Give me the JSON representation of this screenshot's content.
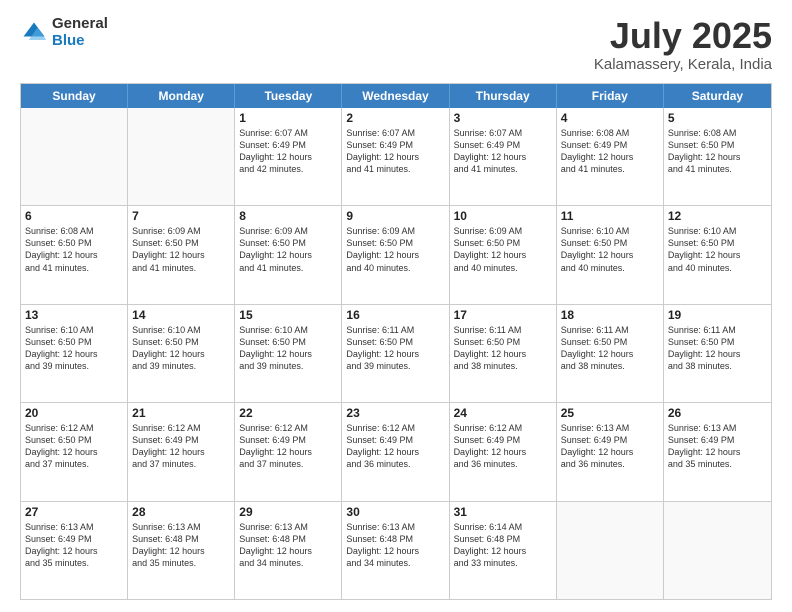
{
  "logo": {
    "general": "General",
    "blue": "Blue"
  },
  "calendar": {
    "title": "July 2025",
    "subtitle": "Kalamassery, Kerala, India",
    "days": [
      "Sunday",
      "Monday",
      "Tuesday",
      "Wednesday",
      "Thursday",
      "Friday",
      "Saturday"
    ],
    "weeks": [
      [
        {
          "day": "",
          "lines": []
        },
        {
          "day": "",
          "lines": []
        },
        {
          "day": "1",
          "lines": [
            "Sunrise: 6:07 AM",
            "Sunset: 6:49 PM",
            "Daylight: 12 hours",
            "and 42 minutes."
          ]
        },
        {
          "day": "2",
          "lines": [
            "Sunrise: 6:07 AM",
            "Sunset: 6:49 PM",
            "Daylight: 12 hours",
            "and 41 minutes."
          ]
        },
        {
          "day": "3",
          "lines": [
            "Sunrise: 6:07 AM",
            "Sunset: 6:49 PM",
            "Daylight: 12 hours",
            "and 41 minutes."
          ]
        },
        {
          "day": "4",
          "lines": [
            "Sunrise: 6:08 AM",
            "Sunset: 6:49 PM",
            "Daylight: 12 hours",
            "and 41 minutes."
          ]
        },
        {
          "day": "5",
          "lines": [
            "Sunrise: 6:08 AM",
            "Sunset: 6:50 PM",
            "Daylight: 12 hours",
            "and 41 minutes."
          ]
        }
      ],
      [
        {
          "day": "6",
          "lines": [
            "Sunrise: 6:08 AM",
            "Sunset: 6:50 PM",
            "Daylight: 12 hours",
            "and 41 minutes."
          ]
        },
        {
          "day": "7",
          "lines": [
            "Sunrise: 6:09 AM",
            "Sunset: 6:50 PM",
            "Daylight: 12 hours",
            "and 41 minutes."
          ]
        },
        {
          "day": "8",
          "lines": [
            "Sunrise: 6:09 AM",
            "Sunset: 6:50 PM",
            "Daylight: 12 hours",
            "and 41 minutes."
          ]
        },
        {
          "day": "9",
          "lines": [
            "Sunrise: 6:09 AM",
            "Sunset: 6:50 PM",
            "Daylight: 12 hours",
            "and 40 minutes."
          ]
        },
        {
          "day": "10",
          "lines": [
            "Sunrise: 6:09 AM",
            "Sunset: 6:50 PM",
            "Daylight: 12 hours",
            "and 40 minutes."
          ]
        },
        {
          "day": "11",
          "lines": [
            "Sunrise: 6:10 AM",
            "Sunset: 6:50 PM",
            "Daylight: 12 hours",
            "and 40 minutes."
          ]
        },
        {
          "day": "12",
          "lines": [
            "Sunrise: 6:10 AM",
            "Sunset: 6:50 PM",
            "Daylight: 12 hours",
            "and 40 minutes."
          ]
        }
      ],
      [
        {
          "day": "13",
          "lines": [
            "Sunrise: 6:10 AM",
            "Sunset: 6:50 PM",
            "Daylight: 12 hours",
            "and 39 minutes."
          ]
        },
        {
          "day": "14",
          "lines": [
            "Sunrise: 6:10 AM",
            "Sunset: 6:50 PM",
            "Daylight: 12 hours",
            "and 39 minutes."
          ]
        },
        {
          "day": "15",
          "lines": [
            "Sunrise: 6:10 AM",
            "Sunset: 6:50 PM",
            "Daylight: 12 hours",
            "and 39 minutes."
          ]
        },
        {
          "day": "16",
          "lines": [
            "Sunrise: 6:11 AM",
            "Sunset: 6:50 PM",
            "Daylight: 12 hours",
            "and 39 minutes."
          ]
        },
        {
          "day": "17",
          "lines": [
            "Sunrise: 6:11 AM",
            "Sunset: 6:50 PM",
            "Daylight: 12 hours",
            "and 38 minutes."
          ]
        },
        {
          "day": "18",
          "lines": [
            "Sunrise: 6:11 AM",
            "Sunset: 6:50 PM",
            "Daylight: 12 hours",
            "and 38 minutes."
          ]
        },
        {
          "day": "19",
          "lines": [
            "Sunrise: 6:11 AM",
            "Sunset: 6:50 PM",
            "Daylight: 12 hours",
            "and 38 minutes."
          ]
        }
      ],
      [
        {
          "day": "20",
          "lines": [
            "Sunrise: 6:12 AM",
            "Sunset: 6:50 PM",
            "Daylight: 12 hours",
            "and 37 minutes."
          ]
        },
        {
          "day": "21",
          "lines": [
            "Sunrise: 6:12 AM",
            "Sunset: 6:49 PM",
            "Daylight: 12 hours",
            "and 37 minutes."
          ]
        },
        {
          "day": "22",
          "lines": [
            "Sunrise: 6:12 AM",
            "Sunset: 6:49 PM",
            "Daylight: 12 hours",
            "and 37 minutes."
          ]
        },
        {
          "day": "23",
          "lines": [
            "Sunrise: 6:12 AM",
            "Sunset: 6:49 PM",
            "Daylight: 12 hours",
            "and 36 minutes."
          ]
        },
        {
          "day": "24",
          "lines": [
            "Sunrise: 6:12 AM",
            "Sunset: 6:49 PM",
            "Daylight: 12 hours",
            "and 36 minutes."
          ]
        },
        {
          "day": "25",
          "lines": [
            "Sunrise: 6:13 AM",
            "Sunset: 6:49 PM",
            "Daylight: 12 hours",
            "and 36 minutes."
          ]
        },
        {
          "day": "26",
          "lines": [
            "Sunrise: 6:13 AM",
            "Sunset: 6:49 PM",
            "Daylight: 12 hours",
            "and 35 minutes."
          ]
        }
      ],
      [
        {
          "day": "27",
          "lines": [
            "Sunrise: 6:13 AM",
            "Sunset: 6:49 PM",
            "Daylight: 12 hours",
            "and 35 minutes."
          ]
        },
        {
          "day": "28",
          "lines": [
            "Sunrise: 6:13 AM",
            "Sunset: 6:48 PM",
            "Daylight: 12 hours",
            "and 35 minutes."
          ]
        },
        {
          "day": "29",
          "lines": [
            "Sunrise: 6:13 AM",
            "Sunset: 6:48 PM",
            "Daylight: 12 hours",
            "and 34 minutes."
          ]
        },
        {
          "day": "30",
          "lines": [
            "Sunrise: 6:13 AM",
            "Sunset: 6:48 PM",
            "Daylight: 12 hours",
            "and 34 minutes."
          ]
        },
        {
          "day": "31",
          "lines": [
            "Sunrise: 6:14 AM",
            "Sunset: 6:48 PM",
            "Daylight: 12 hours",
            "and 33 minutes."
          ]
        },
        {
          "day": "",
          "lines": []
        },
        {
          "day": "",
          "lines": []
        }
      ]
    ]
  }
}
